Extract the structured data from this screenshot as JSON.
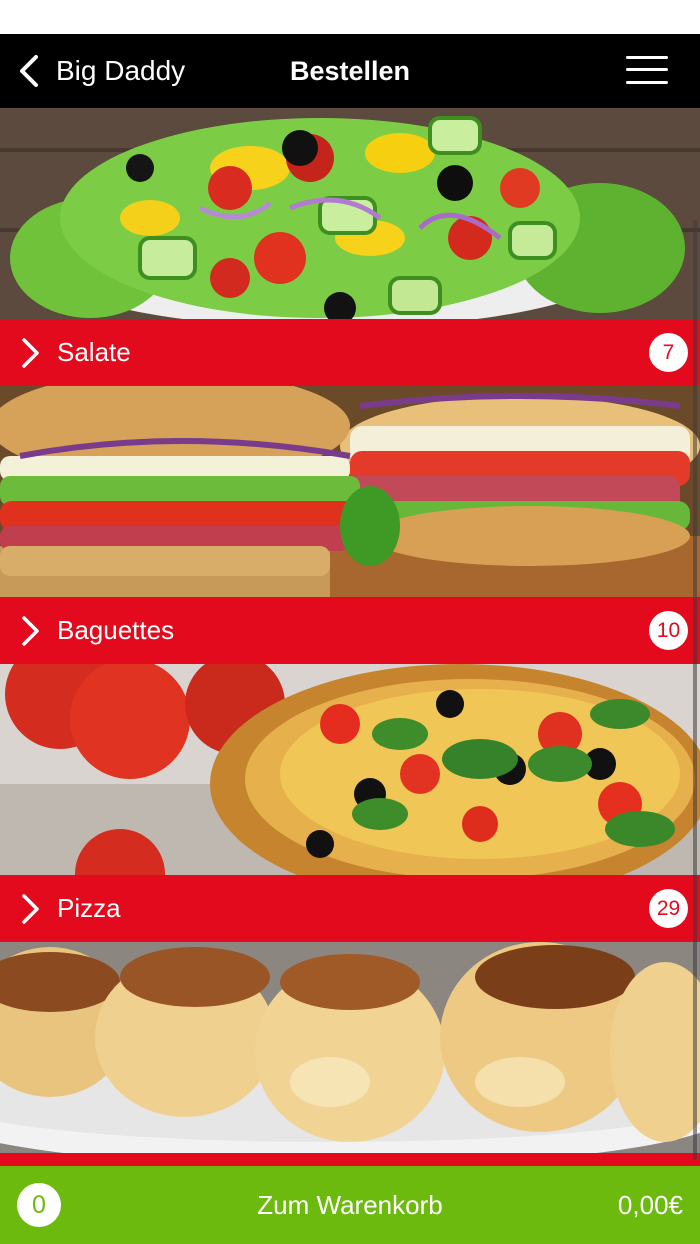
{
  "theme": {
    "nav_bg": "#000000",
    "accent_red": "#e20a1c",
    "cart_green": "#6dba0f"
  },
  "nav": {
    "back_label": "Big Daddy",
    "title": "Bestellen",
    "back_icon": "chevron-left-icon",
    "menu_icon": "hamburger-menu-icon"
  },
  "categories": [
    {
      "label": "Salate",
      "count": "7",
      "image": "salad-photo"
    },
    {
      "label": "Baguettes",
      "count": "10",
      "image": "baguette-sandwich-photo"
    },
    {
      "label": "Pizza",
      "count": "29",
      "image": "pizza-photo"
    },
    {
      "image": "baked-rolls-photo"
    }
  ],
  "cart": {
    "count": "0",
    "label": "Zum Warenkorb",
    "total": "0,00€"
  }
}
